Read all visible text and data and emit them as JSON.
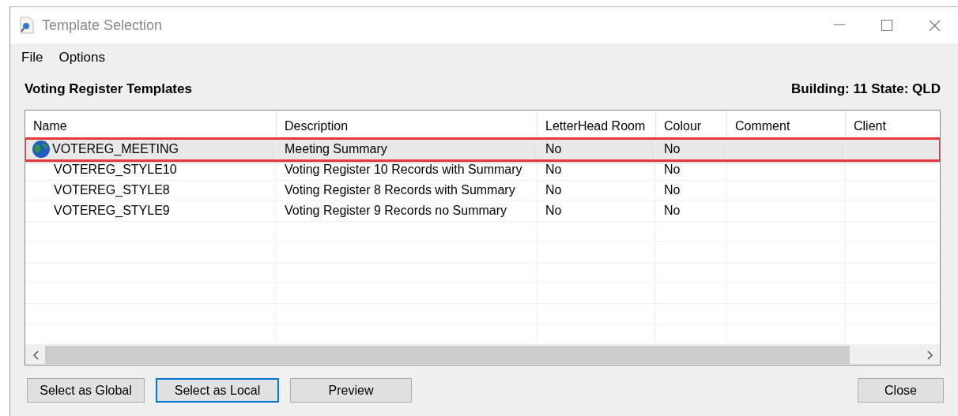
{
  "window": {
    "title": "Template Selection"
  },
  "menu": [
    "File",
    "Options"
  ],
  "header": {
    "title": "Voting Register Templates",
    "info": "Building: 11 State: QLD"
  },
  "table": {
    "columns": [
      "Name",
      "Description",
      "LetterHead Room",
      "Colour",
      "Comment",
      "Client"
    ],
    "rows": [
      {
        "kind": "global",
        "selected": true,
        "cells": [
          "VOTEREG_MEETING",
          "Meeting Summary",
          "No",
          "No"
        ]
      },
      {
        "kind": "plain",
        "selected": false,
        "cells": [
          "VOTEREG_STYLE10",
          "Voting Register 10 Records with Summary",
          "No",
          "No"
        ]
      },
      {
        "kind": "plain",
        "selected": false,
        "cells": [
          "VOTEREG_STYLE8",
          "Voting Register 8 Records with Summary",
          "No",
          "No"
        ]
      },
      {
        "kind": "plain",
        "selected": false,
        "cells": [
          "VOTEREG_STYLE9",
          "Voting Register 9 Records no Summary",
          "No",
          "No"
        ]
      }
    ]
  },
  "buttons": [
    {
      "label": "Select as Global",
      "focused": false
    },
    {
      "label": "Select as Local",
      "focused": true
    },
    {
      "label": "Preview",
      "focused": false
    }
  ],
  "close_button": {
    "label": "Close",
    "focused": false
  }
}
